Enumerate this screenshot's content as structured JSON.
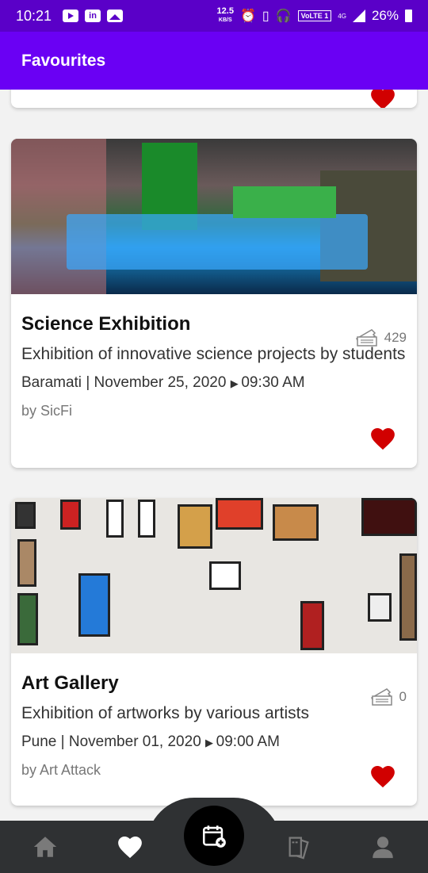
{
  "status_bar": {
    "time": "10:21",
    "speed_value": "12.5",
    "speed_unit": "KB/S",
    "network_label": "VoLTE 1",
    "network_type": "4G",
    "battery": "26%"
  },
  "app_bar": {
    "title": "Favourites"
  },
  "events": [
    {
      "title": "Science Exhibition",
      "description": "Exhibition of innovative science projects by students",
      "location": "Baramati",
      "date": "November 25, 2020",
      "time": "09:30 AM",
      "organizer": "by SicFi",
      "tickets": "429",
      "favourited": true,
      "image": "science-exhibition-photo"
    },
    {
      "title": "Art Gallery",
      "description": "Exhibition of artworks by various artists",
      "location": "Pune",
      "date": "November 01, 2020",
      "time": "09:00 AM",
      "organizer": "by Art Attack",
      "tickets": "0",
      "favourited": true,
      "image": "art-gallery-photo"
    }
  ],
  "bottom_nav": {
    "items": [
      "home-icon",
      "heart-icon",
      "calendar-add-icon",
      "tickets-icon",
      "profile-icon"
    ],
    "active": "heart-icon"
  },
  "colors": {
    "status_bar": "#5a00c8",
    "app_bar": "#6a00f4",
    "heart": "#d10000",
    "nav_background": "#2f3133"
  }
}
